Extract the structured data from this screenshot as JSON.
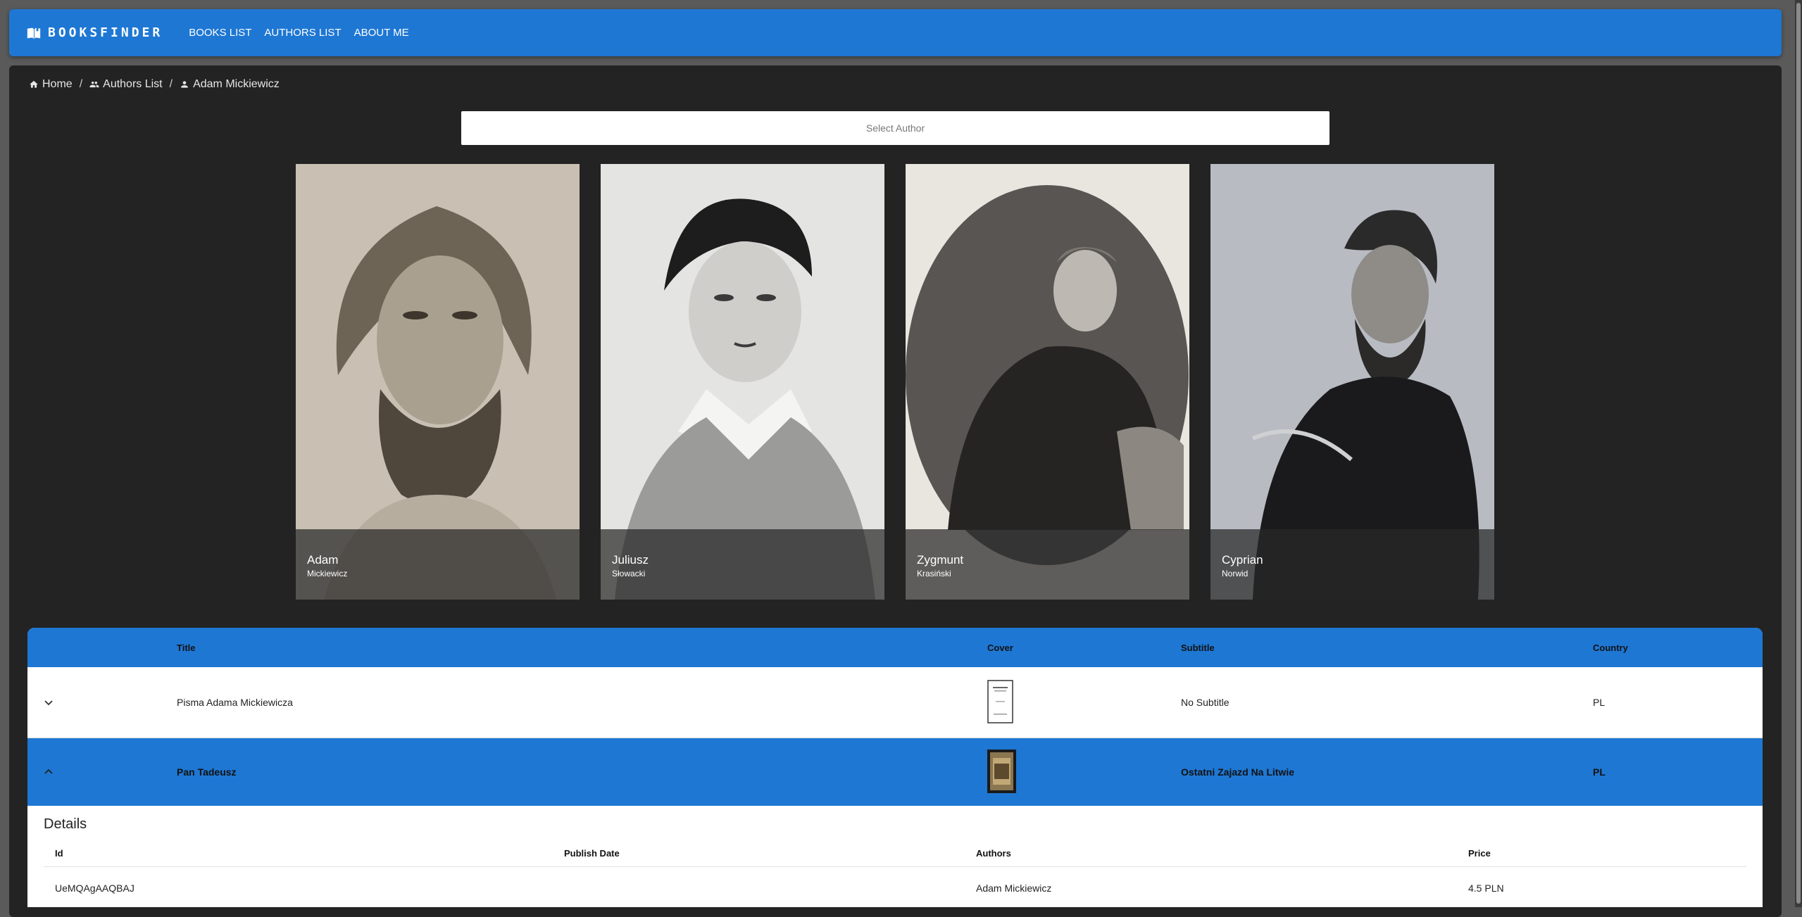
{
  "appbar": {
    "brand": "BOOKSFINDER",
    "nav": [
      "BOOKS LIST",
      "AUTHORS LIST",
      "ABOUT ME"
    ]
  },
  "breadcrumb": {
    "home": "Home",
    "authors": "Authors List",
    "current": "Adam Mickiewicz",
    "separator": "/"
  },
  "select": {
    "placeholder": "Select Author"
  },
  "authors": [
    {
      "first": "Adam",
      "last": "Mickiewicz"
    },
    {
      "first": "Juliusz",
      "last": "Słowacki"
    },
    {
      "first": "Zygmunt",
      "last": "Krasiński"
    },
    {
      "first": "Cyprian",
      "last": "Norwid"
    }
  ],
  "table": {
    "headers": {
      "title": "Title",
      "cover": "Cover",
      "subtitle": "Subtitle",
      "country": "Country"
    },
    "rows": [
      {
        "title": "Pisma Adama Mickiewicza",
        "subtitle": "No Subtitle",
        "country": "PL"
      },
      {
        "title": "Pan Tadeusz",
        "subtitle": "Ostatni Zajazd Na Litwie",
        "country": "PL"
      }
    ]
  },
  "details": {
    "title": "Details",
    "headers": {
      "id": "Id",
      "publish_date": "Publish Date",
      "authors": "Authors",
      "price": "Price"
    },
    "row": {
      "id": "UeMQAgAAQBAJ",
      "publish_date": "",
      "authors": "Adam Mickiewicz",
      "price": "4.5 PLN"
    }
  },
  "colors": {
    "accent": "#1e77d3",
    "panel": "#232323",
    "background": "#5a5a5a"
  }
}
